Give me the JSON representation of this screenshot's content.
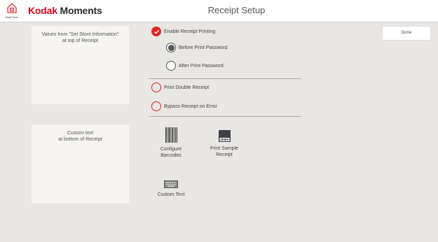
{
  "header": {
    "start_over_label": "Start Over",
    "brand_first": "Kodak",
    "brand_second": "Moments",
    "title": "Receipt Setup"
  },
  "info_top": {
    "line1": "Values from \"Set Store Information\"",
    "line2": "at top of Receipt"
  },
  "info_bottom": {
    "line1": "Custom text",
    "line2": "at bottom of Receipt"
  },
  "options": {
    "enable_receipt_printing": {
      "label": "Enable Receipt Printing",
      "checked": true
    },
    "before_print_password": {
      "label": "Before Print Password",
      "selected": true
    },
    "after_print_password": {
      "label": "After Print Password",
      "selected": false
    },
    "print_double_receipt": {
      "label": "Print Double Receipt",
      "checked": false
    },
    "bypass_receipt_on_error": {
      "label": "Bypass Receipt on Error",
      "checked": false
    }
  },
  "tools": {
    "configure_barcodes": {
      "line1": "Configure",
      "line2": "Barcodes",
      "icon": "barcode-icon"
    },
    "print_sample_receipt": {
      "line1": "Print Sample",
      "line2": "Receipt",
      "icon": "printer-icon"
    },
    "custom_text": {
      "line1": "Custom Text",
      "icon": "keyboard-icon"
    }
  },
  "done_label": "Done",
  "colors": {
    "brand_red": "#e3001b",
    "check_red": "#e0262a",
    "panel_bg": "#e9e7e3",
    "box_bg": "#f5f4f1"
  }
}
